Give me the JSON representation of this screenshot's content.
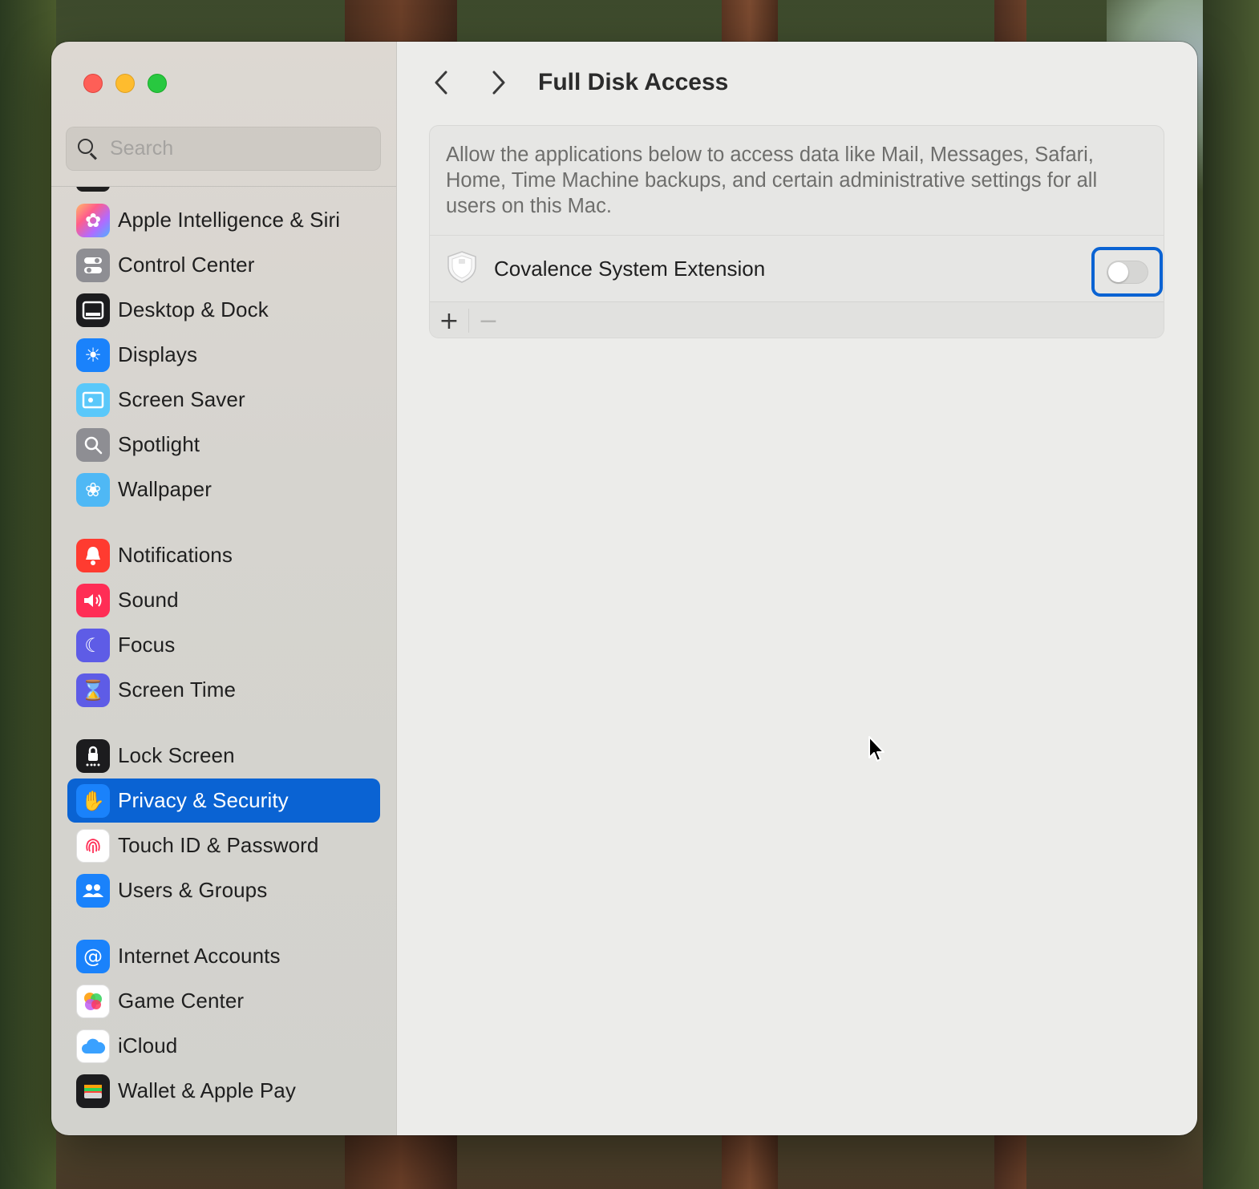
{
  "window": {
    "title": "Full Disk Access"
  },
  "sidebar": {
    "search_placeholder": "Search",
    "items": [
      {
        "label": "Apple Intelligence & Siri",
        "icon": "apple-intelligence-icon",
        "color": "#f2f2f2"
      },
      {
        "label": "Control Center",
        "icon": "control-center-icon",
        "color": "#8e8e93"
      },
      {
        "label": "Desktop & Dock",
        "icon": "desktop-dock-icon",
        "color": "#1c1c1e"
      },
      {
        "label": "Displays",
        "icon": "displays-icon",
        "color": "#1a82fb"
      },
      {
        "label": "Screen Saver",
        "icon": "screen-saver-icon",
        "color": "#5ac8fa"
      },
      {
        "label": "Spotlight",
        "icon": "spotlight-icon",
        "color": "#8e8e93"
      },
      {
        "label": "Wallpaper",
        "icon": "wallpaper-icon",
        "color": "#4fb8f5"
      },
      {
        "label": "Notifications",
        "icon": "notifications-icon",
        "color": "#ff3b30"
      },
      {
        "label": "Sound",
        "icon": "sound-icon",
        "color": "#ff2d55"
      },
      {
        "label": "Focus",
        "icon": "focus-icon",
        "color": "#5e5ce6"
      },
      {
        "label": "Screen Time",
        "icon": "screen-time-icon",
        "color": "#5e5ce6"
      },
      {
        "label": "Lock Screen",
        "icon": "lock-screen-icon",
        "color": "#1c1c1e"
      },
      {
        "label": "Privacy & Security",
        "icon": "privacy-hand-icon",
        "color": "#1a82fb",
        "selected": true
      },
      {
        "label": "Touch ID & Password",
        "icon": "fingerprint-icon",
        "color": "#ffffff"
      },
      {
        "label": "Users & Groups",
        "icon": "users-groups-icon",
        "color": "#1a82fb"
      },
      {
        "label": "Internet Accounts",
        "icon": "at-sign-icon",
        "color": "#1a82fb"
      },
      {
        "label": "Game Center",
        "icon": "game-center-icon",
        "color": "#ffffff"
      },
      {
        "label": "iCloud",
        "icon": "icloud-icon",
        "color": "#ffffff"
      },
      {
        "label": "Wallet & Apple Pay",
        "icon": "wallet-icon",
        "color": "#1c1c1e"
      }
    ]
  },
  "main": {
    "description": "Allow the applications below to access data like Mail, Messages, Safari, Home, Time Machine backups, and certain administrative settings for all users on this Mac.",
    "apps": [
      {
        "name": "Covalence System Extension",
        "enabled": false,
        "icon": "extension-shield-icon"
      }
    ],
    "add_label": "+",
    "remove_label": "−"
  },
  "colors": {
    "accent": "#0a63d3"
  }
}
